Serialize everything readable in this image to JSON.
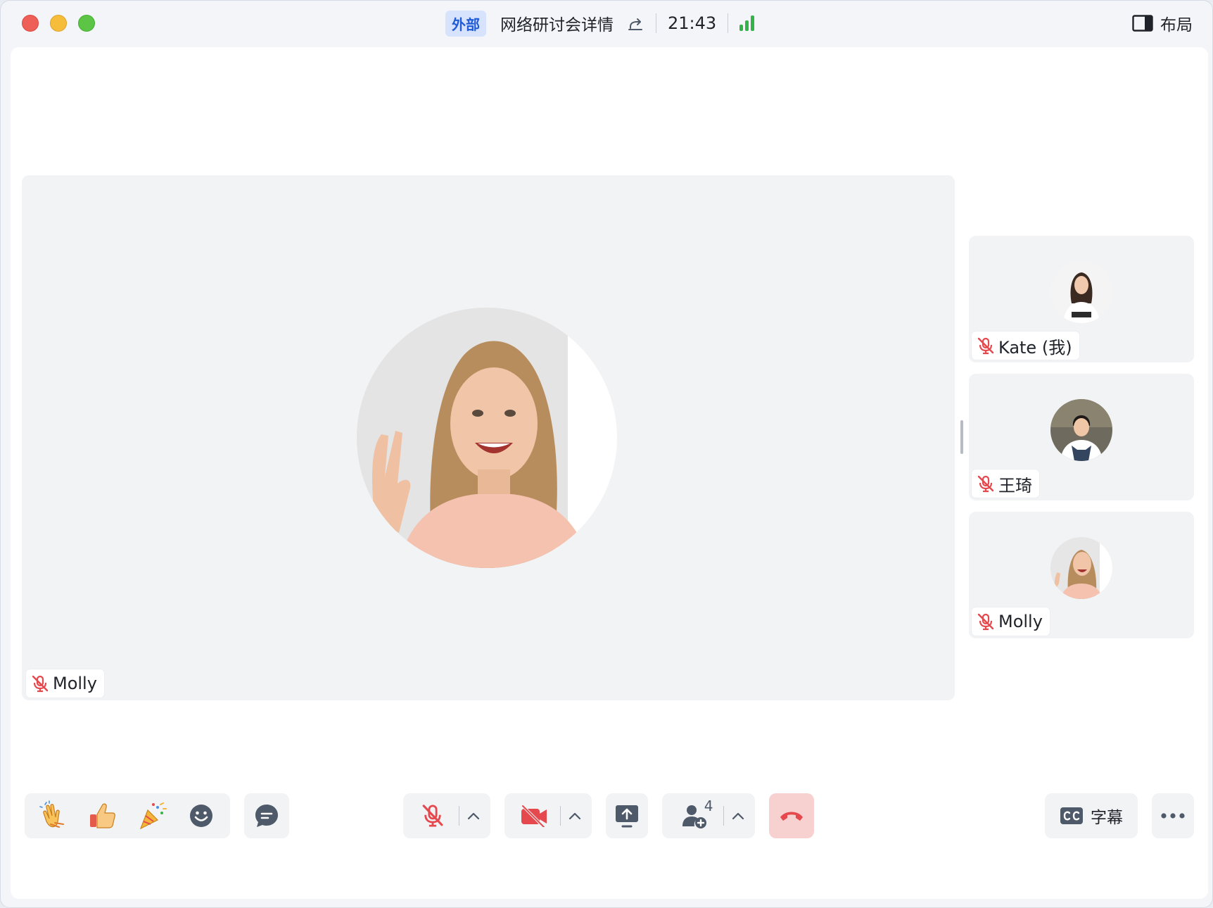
{
  "titlebar": {
    "external_badge": "外部",
    "meeting_title": "网络研讨会详情",
    "timer": "21:43",
    "layout_label": "布局"
  },
  "main_stage": {
    "speaker_name": "Molly"
  },
  "participants": [
    {
      "name": "Kate (我)",
      "muted": true
    },
    {
      "name": "王琦",
      "muted": true
    },
    {
      "name": "Molly",
      "muted": true
    }
  ],
  "toolbar": {
    "participant_count": "4",
    "captions_label": "字幕"
  },
  "colors": {
    "accent": "#1f5bd8",
    "muted_red": "#e5484d",
    "signal_green": "#34b448",
    "end_call_bg": "#f7d0d0"
  }
}
